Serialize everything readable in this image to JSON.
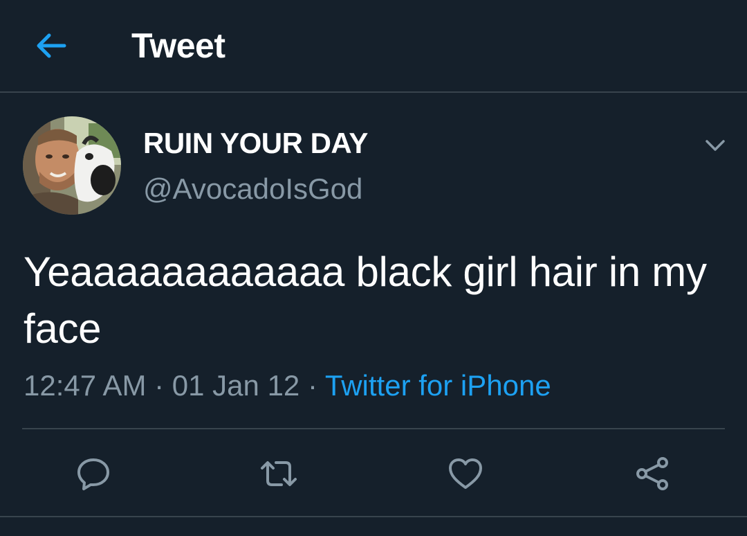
{
  "header": {
    "title": "Tweet",
    "back_icon": "arrow-left-icon"
  },
  "author": {
    "display_name": "RUIN YOUR DAY",
    "handle": "@AvocadoIsGod"
  },
  "tweet": {
    "text": "Yeaaaaaaaaaaaa black girl hair in my face",
    "time": "12:47 AM",
    "separator_1": " · ",
    "date": "01 Jan 12",
    "separator_2": " · ",
    "source": "Twitter for iPhone"
  },
  "actions": [
    {
      "name": "reply",
      "icon": "reply-icon"
    },
    {
      "name": "retweet",
      "icon": "retweet-icon"
    },
    {
      "name": "like",
      "icon": "heart-icon"
    },
    {
      "name": "share",
      "icon": "share-icon"
    }
  ],
  "colors": {
    "background": "#15202b",
    "divider": "#38444d",
    "accent": "#1da1f2",
    "secondary_text": "#8899a6",
    "icon_gray": "#8899a6"
  }
}
